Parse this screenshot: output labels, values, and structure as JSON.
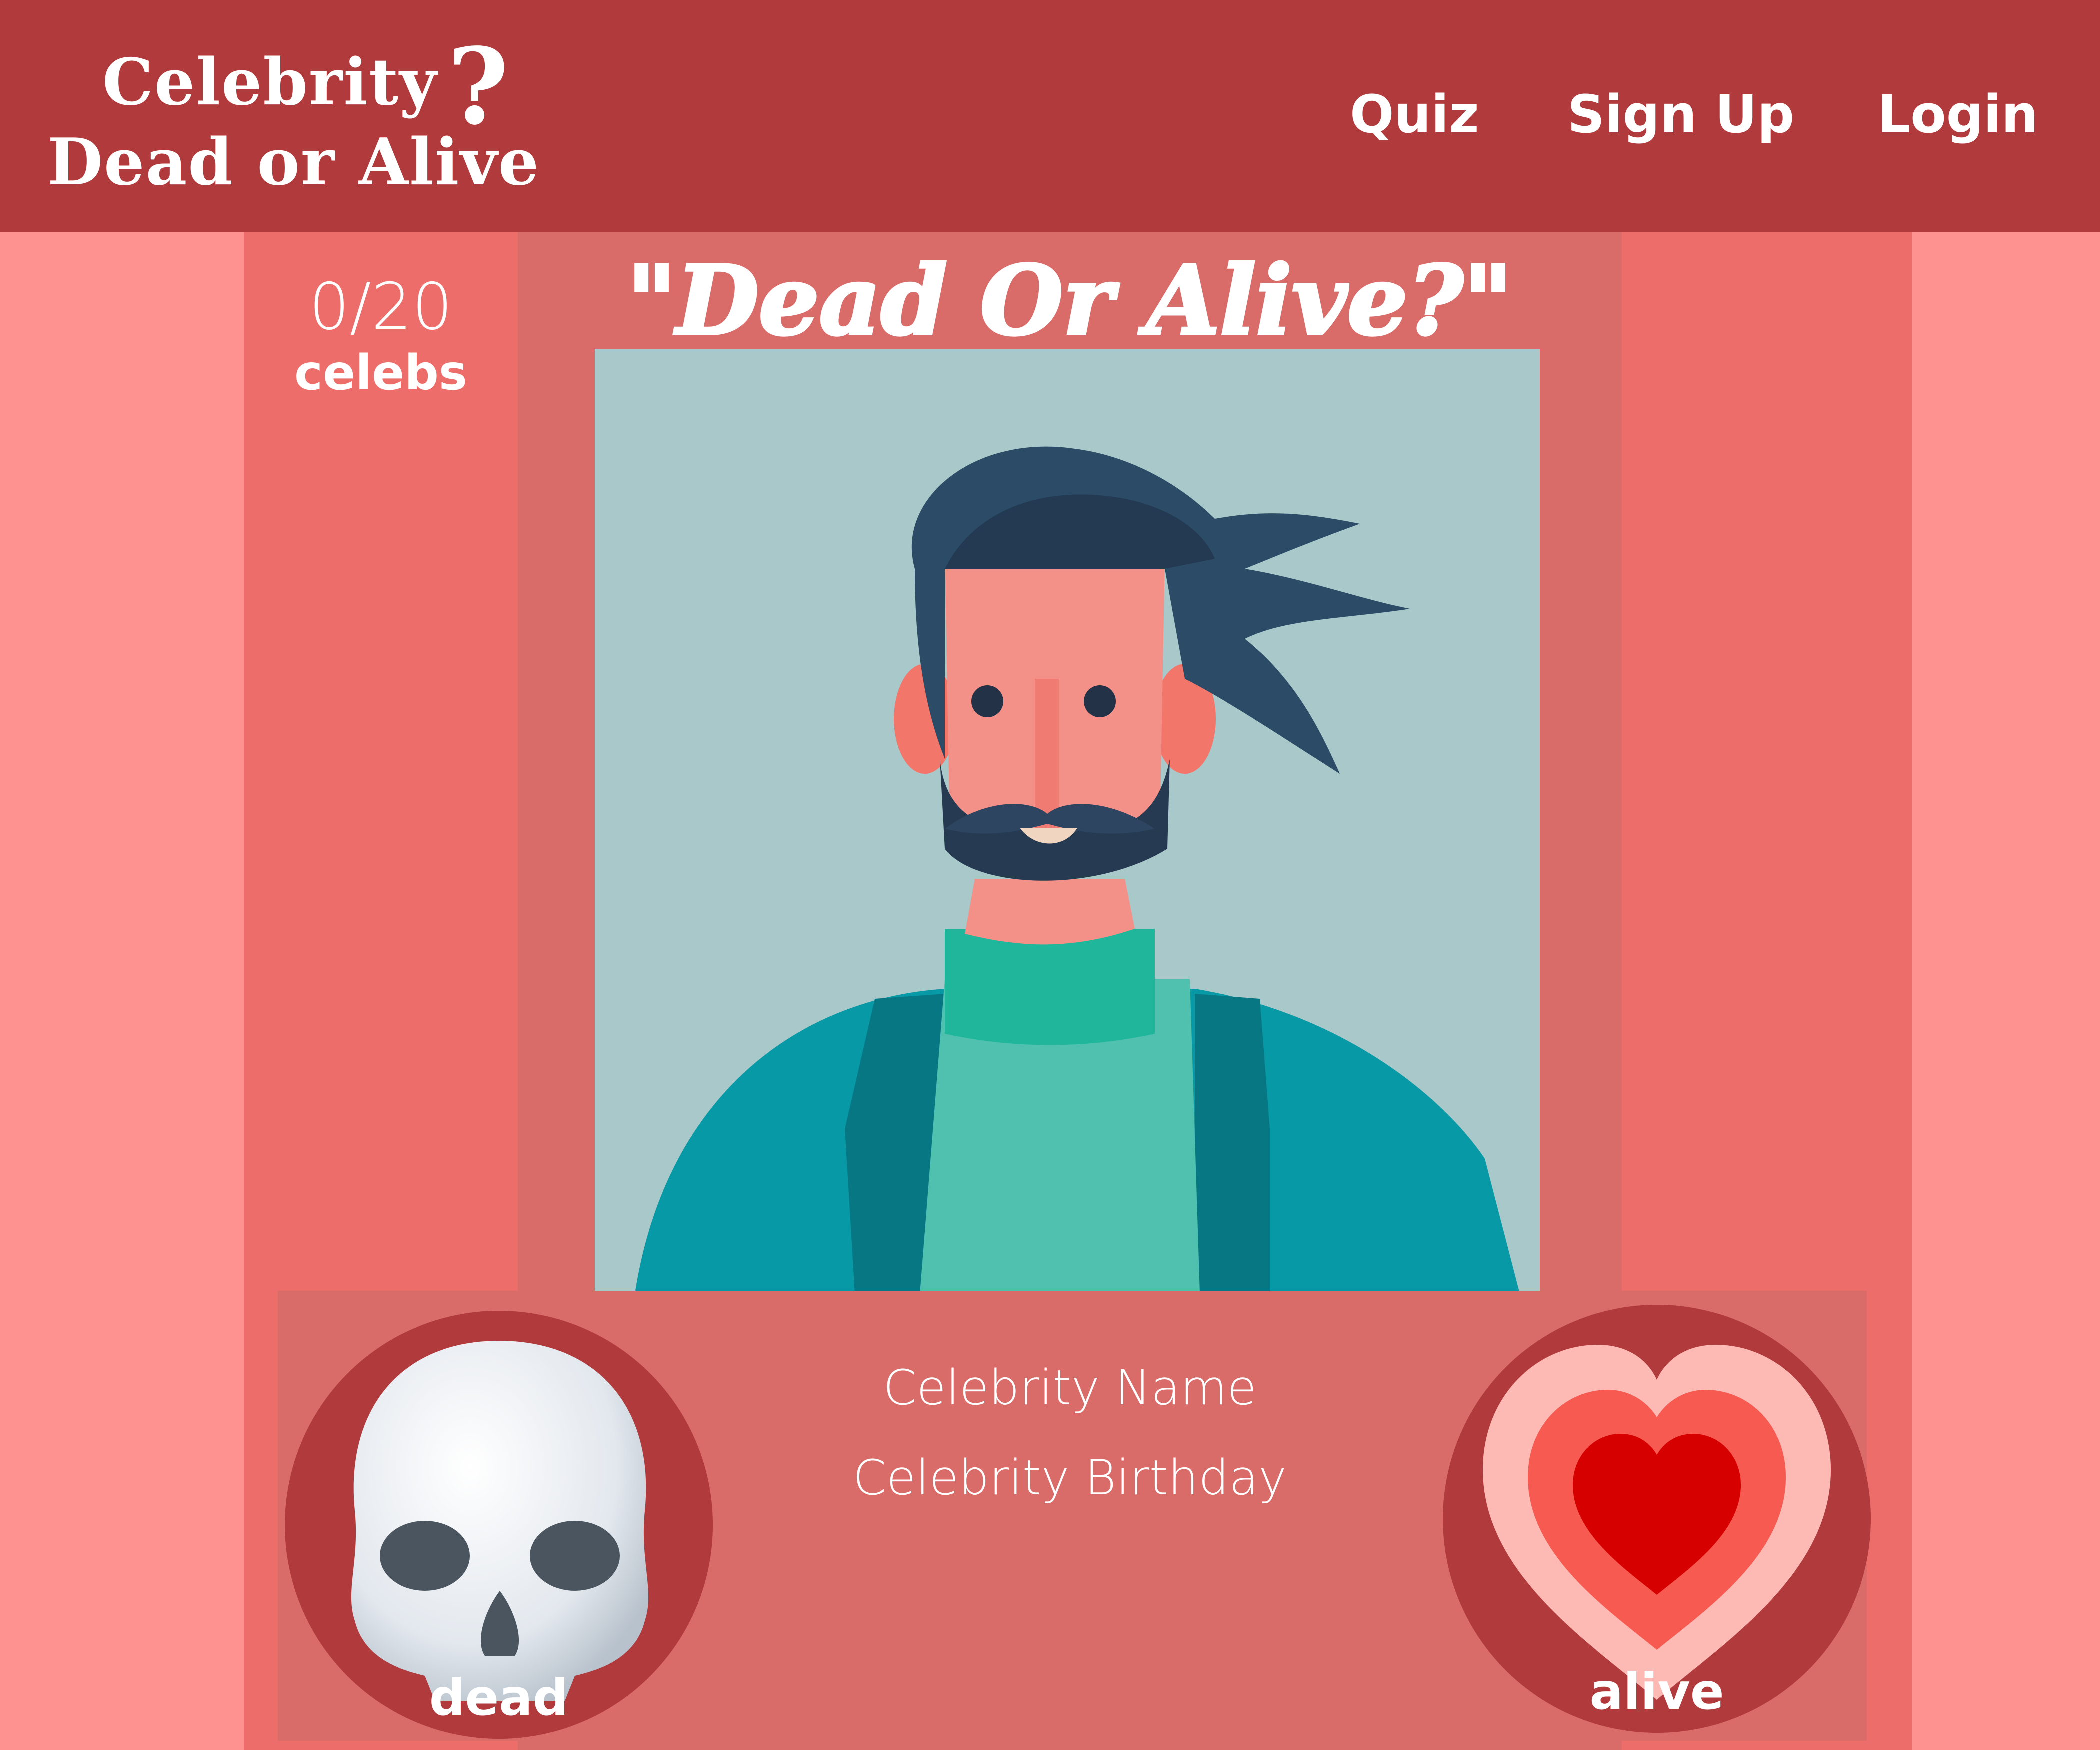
{
  "header": {
    "logo_line1": "Celebrity",
    "logo_question_mark": "?",
    "logo_line2": "Dead or Alive",
    "nav": {
      "quiz": "Quiz",
      "signup": "Sign Up",
      "login": "Login"
    }
  },
  "score": {
    "value": "0/20",
    "label": "celebs"
  },
  "quiz": {
    "title": "\"Dead Or Alive?\"",
    "celebrity_name": "Celebrity Name",
    "celebrity_birthday": "Celebrity Birthday"
  },
  "answers": {
    "dead_label": "dead",
    "dead_icon": "skull-icon",
    "alive_label": "alive",
    "alive_icon": "heart-icon"
  },
  "colors": {
    "header": "#b03a3c",
    "page_bg": "#fd9291",
    "side_column": "#ed6d6b",
    "center_column": "#d96b69",
    "portrait_bg": "#a8c8ca"
  }
}
